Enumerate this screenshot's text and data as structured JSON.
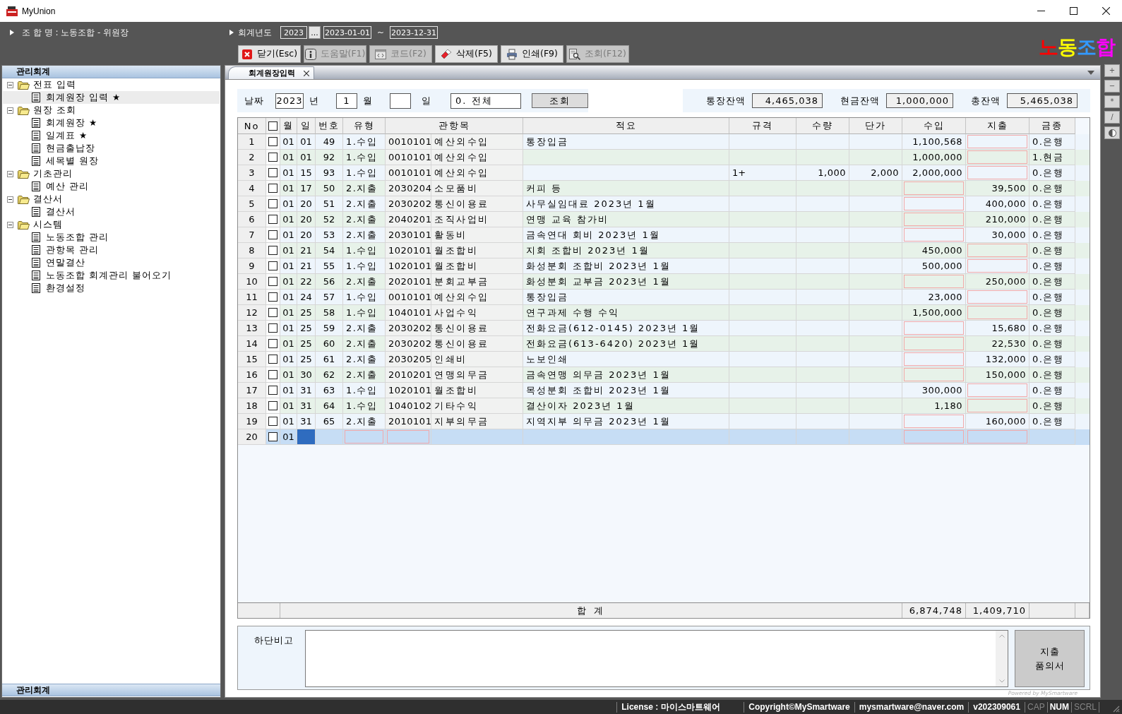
{
  "window": {
    "title": "MyUnion"
  },
  "header": {
    "union": "조 합 명 : 노동조합 - 위원장",
    "fiscal_year": {
      "label": "회계년도",
      "year": "2023",
      "picker": "...",
      "start": "2023-01-01",
      "separator": "~",
      "end": "2023-12-31"
    },
    "logo": [
      {
        "text": "노",
        "color": "#ff0000"
      },
      {
        "text": "동",
        "color": "#ffff00"
      },
      {
        "text": "조",
        "color": "#3399ff"
      },
      {
        "text": "합",
        "color": "#ff00ff"
      }
    ]
  },
  "toolbar": [
    {
      "label": "닫기(Esc)",
      "disabled": false
    },
    {
      "label": "도움말(F1)",
      "disabled": true
    },
    {
      "label": "코드(F2)",
      "disabled": true
    },
    {
      "label": "삭제(F5)",
      "disabled": false
    },
    {
      "label": "인쇄(F9)",
      "disabled": false
    },
    {
      "label": "조회(F12)",
      "disabled": true
    }
  ],
  "sidebar": {
    "title": "관리회계",
    "tree": [
      {
        "label": "전표 입력",
        "expanded": true,
        "selected": false,
        "children": [
          {
            "label": "회계원장 입력 ★",
            "selected": true
          }
        ]
      },
      {
        "label": "원장 조회",
        "expanded": true,
        "selected": false,
        "children": [
          {
            "label": "회계원장 ★",
            "selected": false
          },
          {
            "label": "일계표 ★",
            "selected": false
          },
          {
            "label": "현금출납장",
            "selected": false
          },
          {
            "label": "세목별 원장",
            "selected": false
          }
        ]
      },
      {
        "label": "기초관리",
        "expanded": true,
        "selected": false,
        "children": [
          {
            "label": "예산 관리",
            "selected": false
          }
        ]
      },
      {
        "label": "결산서",
        "expanded": true,
        "selected": false,
        "children": [
          {
            "label": "결산서",
            "selected": false
          }
        ]
      },
      {
        "label": "시스템",
        "expanded": true,
        "selected": false,
        "children": [
          {
            "label": "노동조합 관리",
            "selected": false
          },
          {
            "label": "관항목 관리",
            "selected": false
          },
          {
            "label": "연말결산",
            "selected": false
          },
          {
            "label": "노동조합 회계관리 불어오기",
            "selected": false
          },
          {
            "label": "환경설정",
            "selected": false
          }
        ]
      }
    ],
    "footer": "관리회계"
  },
  "tabs": [
    {
      "label": "회계원장입력",
      "selected": true
    }
  ],
  "side_tools": [
    {
      "label": "+"
    },
    {
      "label": "−"
    },
    {
      "label": "*"
    },
    {
      "label": "/"
    }
  ],
  "filter": {
    "label": "날짜",
    "year": "2023",
    "year_unit": "년",
    "month": "1",
    "month_unit": "월",
    "day_unit": "일",
    "scope": "0. 전체",
    "button": "조회"
  },
  "balances": [
    {
      "label": "통장잔액",
      "value": "4,465,038"
    },
    {
      "label": "현금잔액",
      "value": "1,000,000"
    },
    {
      "label": "총잔액",
      "value": "5,465,038"
    }
  ],
  "table": {
    "columns": [
      "No",
      "월",
      "일",
      "번호",
      "유형",
      "관항목",
      "적요",
      "규격",
      "수량",
      "단가",
      "수입",
      "지출",
      "금종"
    ],
    "select_all_checked": false,
    "rows": [
      {
        "no": "1",
        "checked": false,
        "selected": false,
        "month": "01",
        "day": "01",
        "number": "49",
        "type": "1.수입",
        "code": "0010101",
        "account": "예산외수입",
        "summary": "통장입금",
        "income": "1,100,568",
        "fund": "0.은행"
      },
      {
        "no": "2",
        "checked": false,
        "selected": false,
        "month": "01",
        "day": "01",
        "number": "92",
        "type": "1.수입",
        "code": "0010101",
        "account": "예산외수입",
        "income": "1,000,000",
        "fund": "1.현금"
      },
      {
        "no": "3",
        "checked": false,
        "selected": false,
        "month": "01",
        "day": "15",
        "number": "93",
        "type": "1.수입",
        "code": "0010101",
        "account": "예산외수입",
        "spec": "1+",
        "quantity": "1,000",
        "unit_price": "2,000",
        "income": "2,000,000",
        "fund": "0.은행"
      },
      {
        "no": "4",
        "checked": false,
        "selected": false,
        "month": "01",
        "day": "17",
        "number": "50",
        "type": "2.지출",
        "code": "2030204",
        "account": "소모품비",
        "summary": "커피 등",
        "expense": "39,500",
        "fund": "0.은행"
      },
      {
        "no": "5",
        "checked": false,
        "selected": false,
        "month": "01",
        "day": "20",
        "number": "51",
        "type": "2.지출",
        "code": "2030202",
        "account": "통신이용료",
        "summary": "사무실임대료 2023년 1월",
        "expense": "400,000",
        "fund": "0.은행"
      },
      {
        "no": "6",
        "checked": false,
        "selected": false,
        "month": "01",
        "day": "20",
        "number": "52",
        "type": "2.지출",
        "code": "2040201",
        "account": "조직사업비",
        "summary": "연맹 교육 참가비",
        "expense": "210,000",
        "fund": "0.은행"
      },
      {
        "no": "7",
        "checked": false,
        "selected": false,
        "month": "01",
        "day": "20",
        "number": "53",
        "type": "2.지출",
        "code": "2030101",
        "account": "활동비",
        "summary": "금속연대 회비 2023년 1월",
        "expense": "30,000",
        "fund": "0.은행"
      },
      {
        "no": "8",
        "checked": false,
        "selected": false,
        "month": "01",
        "day": "21",
        "number": "54",
        "type": "1.수입",
        "code": "1020101",
        "account": "월조합비",
        "summary": "지회 조합비 2023년 1월",
        "income": "450,000",
        "fund": "0.은행"
      },
      {
        "no": "9",
        "checked": false,
        "selected": false,
        "month": "01",
        "day": "21",
        "number": "55",
        "type": "1.수입",
        "code": "1020101",
        "account": "월조합비",
        "summary": "화성분회 조합비 2023년 1월",
        "income": "500,000",
        "fund": "0.은행"
      },
      {
        "no": "10",
        "checked": false,
        "selected": false,
        "month": "01",
        "day": "22",
        "number": "56",
        "type": "2.지출",
        "code": "2020101",
        "account": "분회교부금",
        "summary": "화성분회 교부금 2023년 1월",
        "expense": "250,000",
        "fund": "0.은행"
      },
      {
        "no": "11",
        "checked": false,
        "selected": false,
        "month": "01",
        "day": "24",
        "number": "57",
        "type": "1.수입",
        "code": "0010101",
        "account": "예산외수입",
        "summary": "통장입금",
        "income": "23,000",
        "fund": "0.은행"
      },
      {
        "no": "12",
        "checked": false,
        "selected": false,
        "month": "01",
        "day": "25",
        "number": "58",
        "type": "1.수입",
        "code": "1040101",
        "account": "사업수익",
        "summary": "연구과제 수행 수익",
        "income": "1,500,000",
        "fund": "0.은행"
      },
      {
        "no": "13",
        "checked": false,
        "selected": false,
        "month": "01",
        "day": "25",
        "number": "59",
        "type": "2.지출",
        "code": "2030202",
        "account": "통신이용료",
        "summary": "전화요금(612-0145) 2023년 1월",
        "expense": "15,680",
        "fund": "0.은행"
      },
      {
        "no": "14",
        "checked": false,
        "selected": false,
        "month": "01",
        "day": "25",
        "number": "60",
        "type": "2.지출",
        "code": "2030202",
        "account": "통신이용료",
        "summary": "전화요금(613-6420) 2023년 1월",
        "expense": "22,530",
        "fund": "0.은행"
      },
      {
        "no": "15",
        "checked": false,
        "selected": false,
        "month": "01",
        "day": "25",
        "number": "61",
        "type": "2.지출",
        "code": "2030205",
        "account": "인쇄비",
        "summary": "노보인쇄",
        "expense": "132,000",
        "fund": "0.은행"
      },
      {
        "no": "16",
        "checked": false,
        "selected": false,
        "month": "01",
        "day": "30",
        "number": "62",
        "type": "2.지출",
        "code": "2010201",
        "account": "연맹의무금",
        "summary": "금속연맹 의무금 2023년 1월",
        "expense": "150,000",
        "fund": "0.은행"
      },
      {
        "no": "17",
        "checked": false,
        "selected": false,
        "month": "01",
        "day": "31",
        "number": "63",
        "type": "1.수입",
        "code": "1020101",
        "account": "월조합비",
        "summary": "목성분회 조합비 2023년 1월",
        "income": "300,000",
        "fund": "0.은행"
      },
      {
        "no": "18",
        "checked": false,
        "selected": false,
        "month": "01",
        "day": "31",
        "number": "64",
        "type": "1.수입",
        "code": "1040102",
        "account": "기타수익",
        "summary": "결산이자 2023년 1월",
        "income": "1,180",
        "fund": "0.은행"
      },
      {
        "no": "19",
        "checked": false,
        "selected": false,
        "month": "01",
        "day": "31",
        "number": "65",
        "type": "2.지출",
        "code": "2010101",
        "account": "지부의무금",
        "summary": "지역지부 의무금 2023년 1월",
        "expense": "160,000",
        "fund": "0.은행"
      },
      {
        "no": "20",
        "checked": false,
        "selected": true,
        "month": "01"
      }
    ],
    "totals": {
      "label": "합 계",
      "income": "6,874,748",
      "expense": "1,409,710"
    }
  },
  "memo": {
    "label": "하단비고",
    "button_lines": [
      "지출",
      "품의서"
    ]
  },
  "powered_by": "Powered by MySmartware",
  "status_bar": {
    "items": [
      "License : 마이스마트웨어",
      "Copyright©MySmartware",
      "mysmartware@naver.com",
      "v202309061"
    ],
    "indicators": [
      {
        "label": "CAP",
        "on": false
      },
      {
        "label": "NUM",
        "on": true
      },
      {
        "label": "SCRL",
        "on": false
      }
    ]
  }
}
